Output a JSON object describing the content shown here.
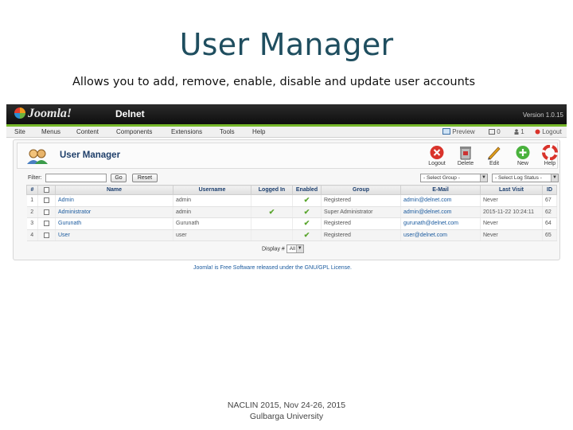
{
  "slide": {
    "title": "User Manager",
    "subtitle": "Allows you to add, remove, enable, disable and update user accounts",
    "footer_line1": "NACLIN 2015, Nov 24-26, 2015",
    "footer_line2": "Gulbarga University"
  },
  "app": {
    "logo_text": "Joomla!",
    "site_name": "Delnet",
    "version": "Version 1.0.15",
    "menu": [
      "Site",
      "Menus",
      "Content",
      "Components",
      "Extensions",
      "Tools",
      "Help"
    ],
    "menu_right": [
      "Preview",
      "0",
      "1",
      "Logout"
    ]
  },
  "page": {
    "heading": "User Manager",
    "toolbar": [
      {
        "label": "Logout",
        "icon": "logout-icon",
        "color": "#d9332b"
      },
      {
        "label": "Delete",
        "icon": "trash-icon",
        "color": "#b03030"
      },
      {
        "label": "Edit",
        "icon": "pencil-icon",
        "color": "#e3a21a"
      },
      {
        "label": "New",
        "icon": "plus-icon",
        "color": "#4ab23d"
      },
      {
        "label": "Help",
        "icon": "lifebuoy-icon",
        "color": "#d9332b"
      }
    ]
  },
  "filter": {
    "label": "Filter:",
    "value": "",
    "go_label": "Go",
    "reset_label": "Reset",
    "group_select": "- Select Group -",
    "status_select": "- Select Log Status -"
  },
  "table": {
    "headers": [
      "#",
      "",
      "Name",
      "Username",
      "Logged In",
      "Enabled",
      "Group",
      "E-Mail",
      "Last Visit",
      "ID"
    ],
    "rows": [
      {
        "num": "1",
        "name": "Admin",
        "username": "admin",
        "logged_in": false,
        "enabled": true,
        "group": "Registered",
        "email": "admin@delnet.com",
        "last_visit": "Never",
        "id": "67"
      },
      {
        "num": "2",
        "name": "Administrator",
        "username": "admin",
        "logged_in": true,
        "enabled": true,
        "group": "Super Administrator",
        "email": "admin@delnet.com",
        "last_visit": "2015-11-22 10:24:11",
        "id": "62"
      },
      {
        "num": "3",
        "name": "Gurunath",
        "username": "Gurunath",
        "logged_in": false,
        "enabled": true,
        "group": "Registered",
        "email": "gurunath@delnet.com",
        "last_visit": "Never",
        "id": "64"
      },
      {
        "num": "4",
        "name": "User",
        "username": "user",
        "logged_in": false,
        "enabled": true,
        "group": "Registered",
        "email": "user@delnet.com",
        "last_visit": "Never",
        "id": "65"
      }
    ]
  },
  "pagination": {
    "display_label": "Display #",
    "value": "All"
  },
  "footer_link": "Joomla! is Free Software released under the GNU/GPL License."
}
